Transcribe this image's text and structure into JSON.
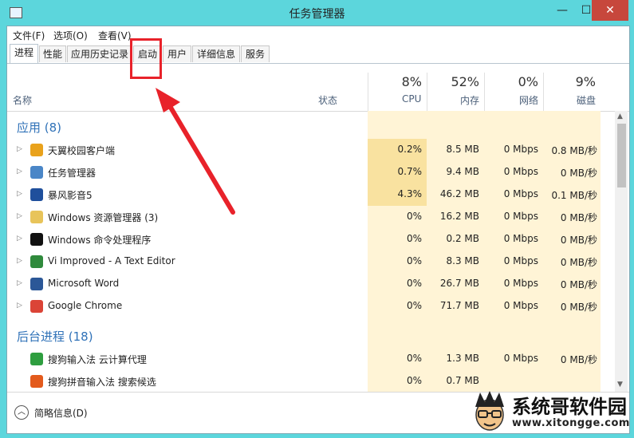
{
  "window": {
    "title": "任务管理器",
    "minimize": "—",
    "maximize": "☐",
    "close": "✕"
  },
  "menu": [
    "文件(F)",
    "选项(O)",
    "查看(V)"
  ],
  "tabs": [
    "进程",
    "性能",
    "应用历史记录",
    "启动",
    "用户",
    "详细信息",
    "服务"
  ],
  "active_tab": "进程",
  "highlighted_tab": "启动",
  "columns": {
    "name": "名称",
    "status": "状态",
    "cpu": {
      "percent": "8%",
      "label": "CPU"
    },
    "memory": {
      "percent": "52%",
      "label": "内存"
    },
    "network": {
      "percent": "0%",
      "label": "网络"
    },
    "disk": {
      "percent": "9%",
      "label": "磁盘"
    }
  },
  "groups": {
    "apps": {
      "label": "应用 (8)",
      "rows": [
        {
          "name": "天翼校园客户端",
          "icon": "tianyi-icon",
          "cpu": "0.2%",
          "mem": "8.5 MB",
          "net": "0 Mbps",
          "disk": "0.8 MB/秒",
          "color": "#e9a21c"
        },
        {
          "name": "任务管理器",
          "icon": "task-manager-icon",
          "cpu": "0.7%",
          "mem": "9.4 MB",
          "net": "0 Mbps",
          "disk": "0 MB/秒",
          "color": "#4a86c7"
        },
        {
          "name": "暴风影音5",
          "icon": "baofeng-icon",
          "cpu": "4.3%",
          "mem": "46.2 MB",
          "net": "0 Mbps",
          "disk": "0.1 MB/秒",
          "color": "#1f4f9c"
        },
        {
          "name": "Windows 资源管理器 (3)",
          "icon": "explorer-icon",
          "cpu": "0%",
          "mem": "16.2 MB",
          "net": "0 Mbps",
          "disk": "0 MB/秒",
          "color": "#e8c45a"
        },
        {
          "name": "Windows 命令处理程序",
          "icon": "cmd-icon",
          "cpu": "0%",
          "mem": "0.2 MB",
          "net": "0 Mbps",
          "disk": "0 MB/秒",
          "color": "#111111"
        },
        {
          "name": "Vi Improved - A Text Editor",
          "icon": "vim-icon",
          "cpu": "0%",
          "mem": "8.3 MB",
          "net": "0 Mbps",
          "disk": "0 MB/秒",
          "color": "#2f8a3c"
        },
        {
          "name": "Microsoft Word",
          "icon": "word-icon",
          "cpu": "0%",
          "mem": "26.7 MB",
          "net": "0 Mbps",
          "disk": "0 MB/秒",
          "color": "#2b5797"
        },
        {
          "name": "Google Chrome",
          "icon": "chrome-icon",
          "cpu": "0%",
          "mem": "71.7 MB",
          "net": "0 Mbps",
          "disk": "0 MB/秒",
          "color": "#db4437"
        }
      ]
    },
    "background": {
      "label": "后台进程 (18)",
      "rows": [
        {
          "name": "搜狗输入法 云计算代理",
          "icon": "sogou-cloud-icon",
          "cpu": "0%",
          "mem": "1.3 MB",
          "net": "0 Mbps",
          "disk": "0 MB/秒",
          "color": "#2e9e3f"
        },
        {
          "name": "搜狗拼音输入法 搜索候选",
          "icon": "sogou-search-icon",
          "cpu": "0%",
          "mem": "0.7 MB",
          "net": "",
          "disk": "",
          "color": "#e35a1c"
        }
      ]
    }
  },
  "footer": {
    "label": "简略信息(D)"
  },
  "watermark": {
    "title": "系统哥软件园",
    "url": "www.xitongge.com"
  },
  "colors": {
    "titlebar": "#5cd6dc",
    "accent": "#3072b8",
    "highlight": "#e8222a",
    "cell_tint": "#fff4d6",
    "cell_hot": "#f9e2a0"
  }
}
